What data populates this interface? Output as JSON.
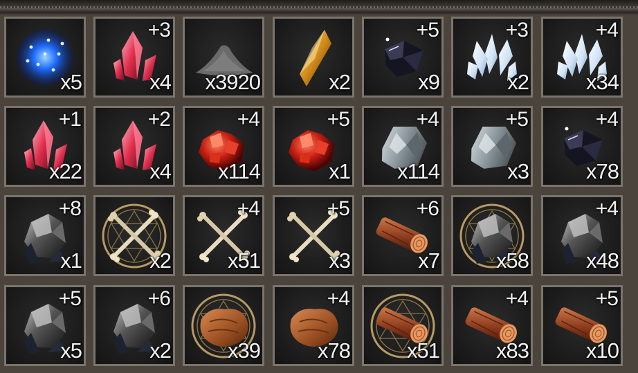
{
  "inventory": {
    "rows": [
      [
        {
          "icon": "blue-sparkle-dust-icon",
          "enhance": "",
          "qty": "x5"
        },
        {
          "icon": "red-crystal-shard-icon",
          "enhance": "+3",
          "qty": "x4"
        },
        {
          "icon": "black-powder-pile-icon",
          "enhance": "",
          "qty": "x3920"
        },
        {
          "icon": "amber-crystal-icon",
          "enhance": "",
          "qty": "x2"
        },
        {
          "icon": "black-gem-icon",
          "enhance": "+5",
          "qty": "x9"
        },
        {
          "icon": "white-crystal-cluster-icon",
          "enhance": "+3",
          "qty": "x2"
        },
        {
          "icon": "white-crystal-cluster-icon",
          "enhance": "+4",
          "qty": "x34"
        }
      ],
      [
        {
          "icon": "red-crystal-shard-icon",
          "enhance": "+1",
          "qty": "x22"
        },
        {
          "icon": "red-crystal-shard-icon",
          "enhance": "+2",
          "qty": "x4"
        },
        {
          "icon": "red-ore-chunks-icon",
          "enhance": "+4",
          "qty": "x114"
        },
        {
          "icon": "red-ore-chunks-icon",
          "enhance": "+5",
          "qty": "x1"
        },
        {
          "icon": "silver-ore-icon",
          "enhance": "+4",
          "qty": "x114"
        },
        {
          "icon": "silver-ore-icon",
          "enhance": "+5",
          "qty": "x3"
        },
        {
          "icon": "black-gem-icon",
          "enhance": "+4",
          "qty": "x78"
        }
      ],
      [
        {
          "icon": "dark-stone-icon",
          "enhance": "+8",
          "qty": "x1"
        },
        {
          "icon": "crossed-bones-sigil-icon",
          "enhance": "",
          "qty": "x2"
        },
        {
          "icon": "crossed-bones-icon",
          "enhance": "+4",
          "qty": "x51"
        },
        {
          "icon": "crossed-bones-icon",
          "enhance": "+5",
          "qty": "x3"
        },
        {
          "icon": "wood-log-icon",
          "enhance": "+6",
          "qty": "x7"
        },
        {
          "icon": "dark-stone-sigil-icon",
          "enhance": "",
          "qty": "x58"
        },
        {
          "icon": "dark-stone-icon",
          "enhance": "+4",
          "qty": "x48"
        }
      ],
      [
        {
          "icon": "dark-stone-icon",
          "enhance": "+5",
          "qty": "x5"
        },
        {
          "icon": "dark-stone-icon",
          "enhance": "+6",
          "qty": "x2"
        },
        {
          "icon": "leather-hide-sigil-icon",
          "enhance": "",
          "qty": "x39"
        },
        {
          "icon": "leather-hide-icon",
          "enhance": "+4",
          "qty": "x78"
        },
        {
          "icon": "wood-log-sigil-icon",
          "enhance": "",
          "qty": "x51"
        },
        {
          "icon": "wood-log-icon",
          "enhance": "+4",
          "qty": "x83"
        },
        {
          "icon": "wood-log-icon",
          "enhance": "+5",
          "qty": "x10"
        }
      ]
    ]
  }
}
